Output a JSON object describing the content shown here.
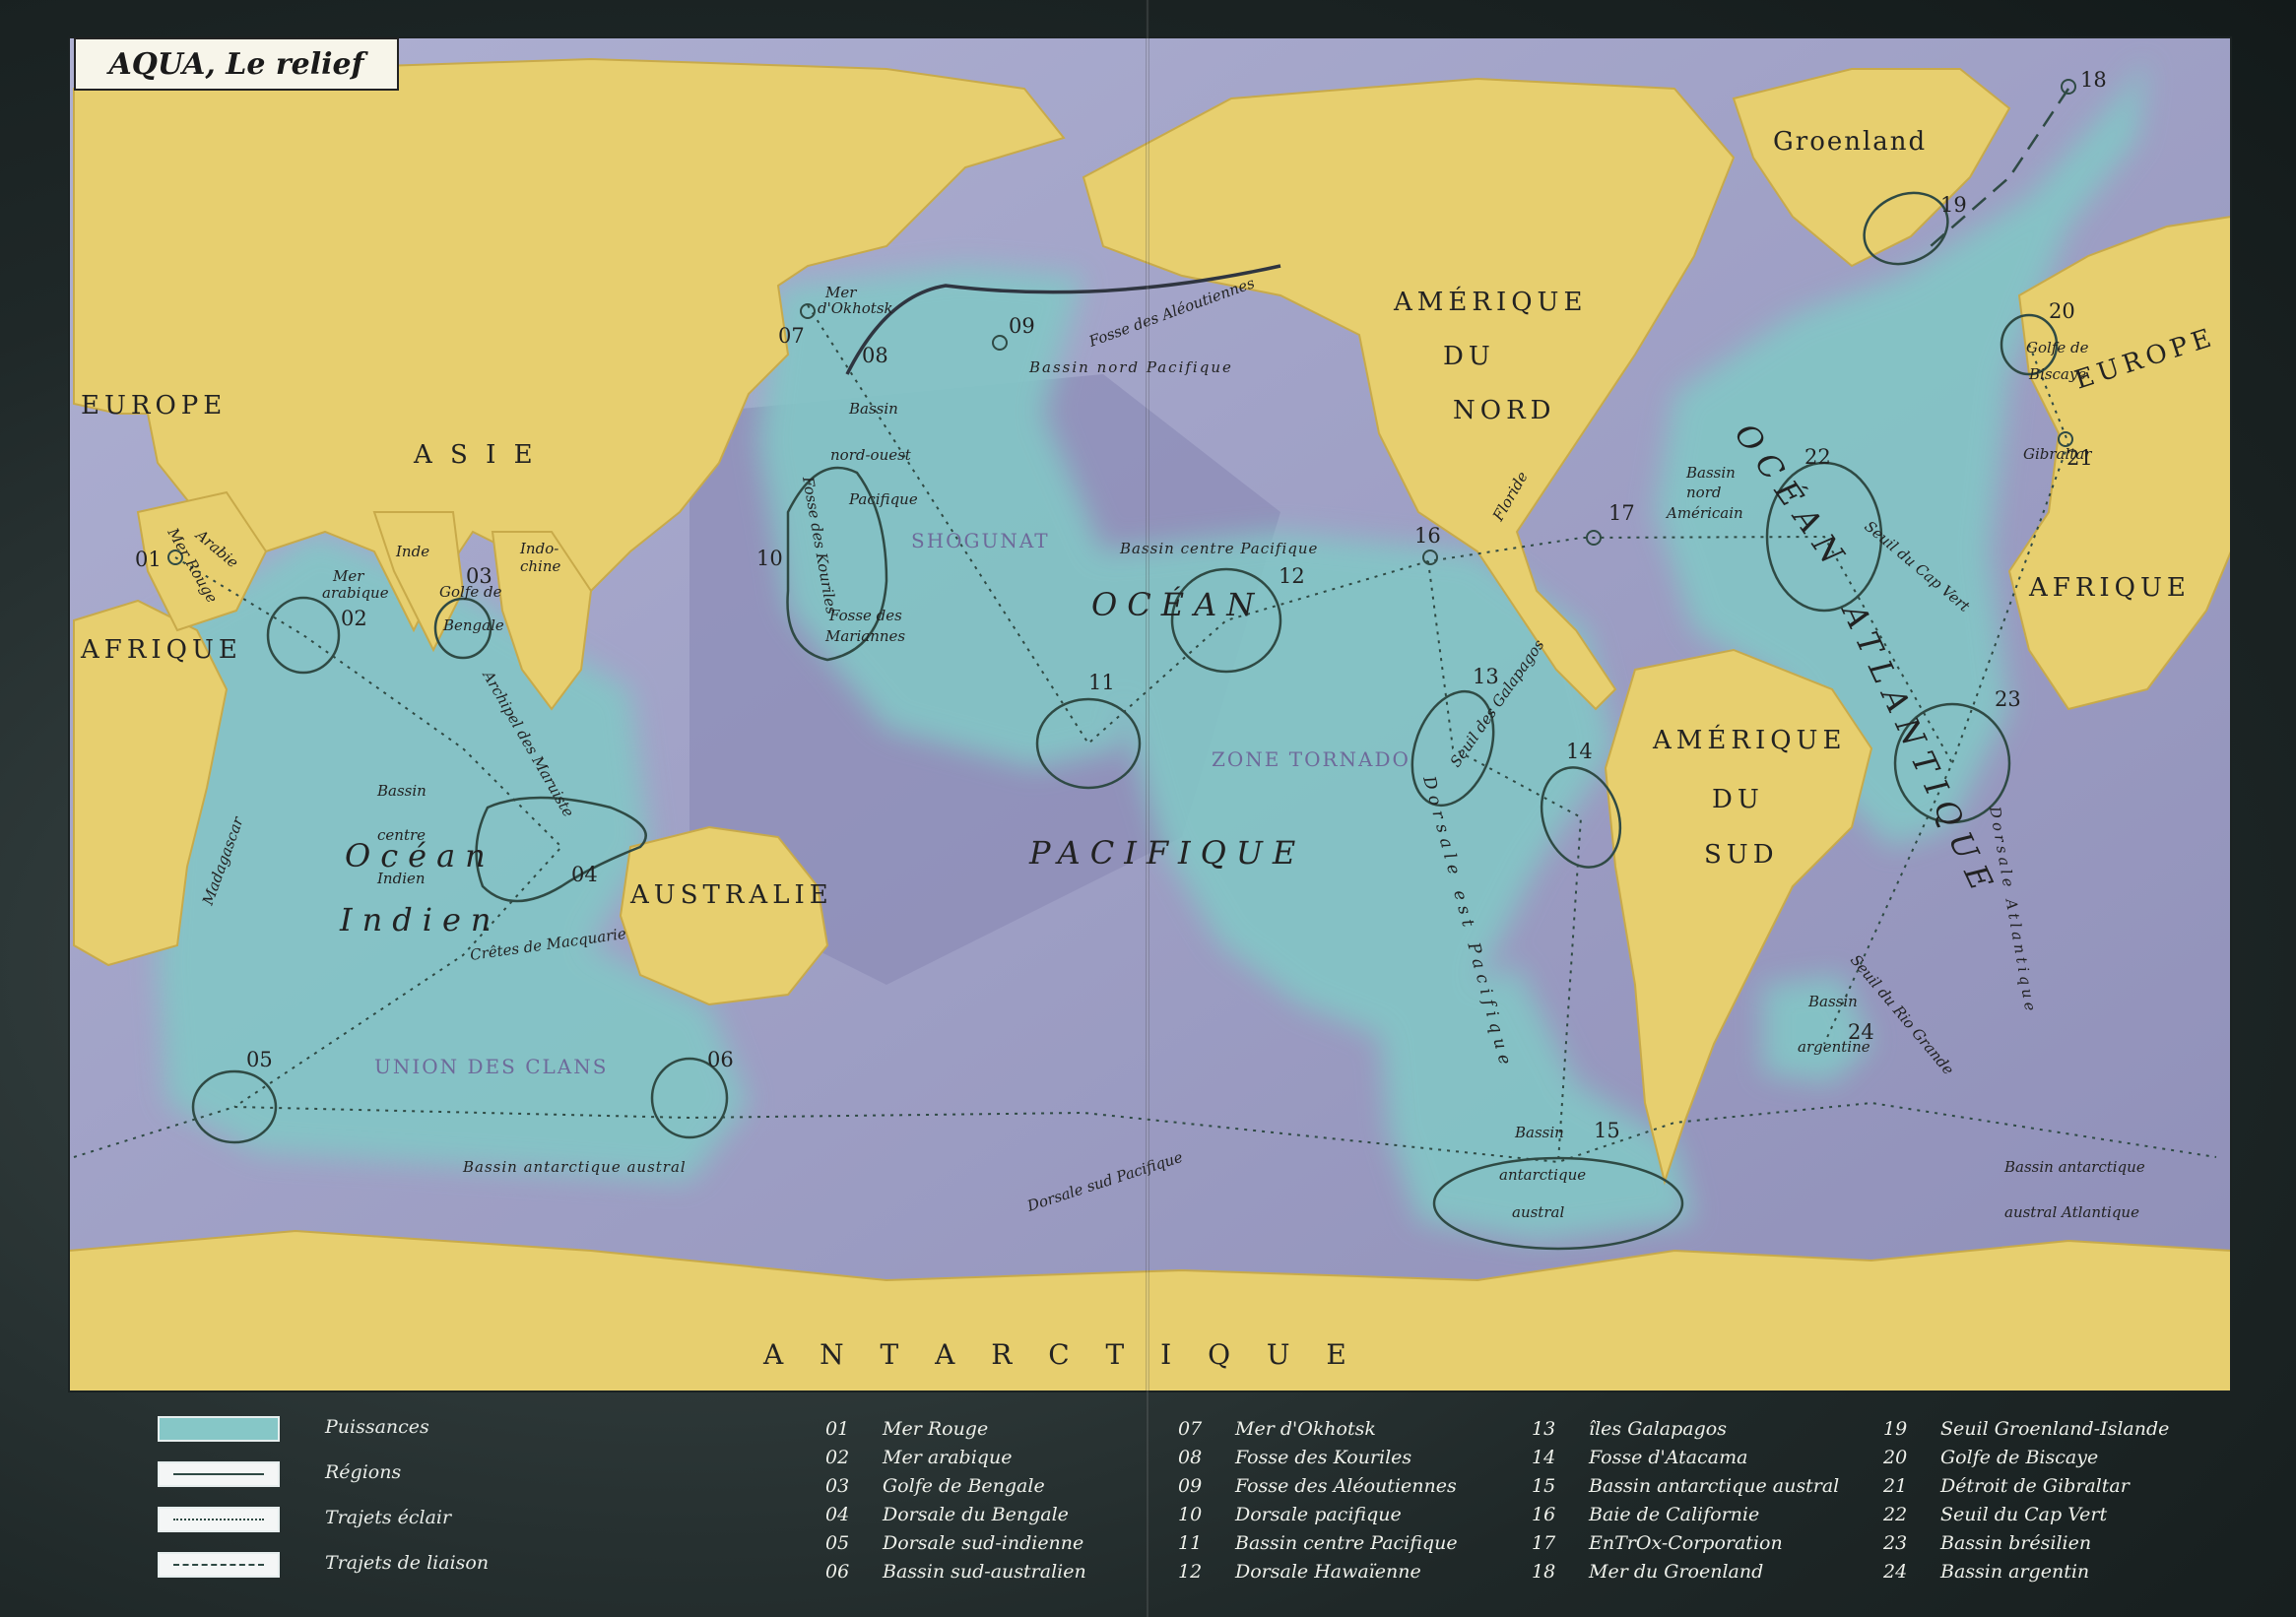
{
  "title": "AQUA, Le relief",
  "colors": {
    "land": "#e7cf6f",
    "ocean_deep": "#9c9bc2",
    "ocean_shelf": "#bdbfdc",
    "power_zone": "#86c7c7",
    "lines": "#2f4a44",
    "background": "#1f2828"
  },
  "map_labels": {
    "continents": {
      "europe_west": "EUROPE",
      "asie": "A S I E",
      "afrique_west": "AFRIQUE",
      "australie": "AUSTRALIE",
      "amerique_nord_1": "AMÉRIQUE",
      "amerique_nord_2": "DU",
      "amerique_nord_3": "NORD",
      "amerique_sud_1": "AMÉRIQUE",
      "amerique_sud_2": "DU",
      "amerique_sud_3": "SUD",
      "groenland": "Groenland",
      "europe_east": "EUROPE",
      "afrique_east": "AFRIQUE",
      "antarctique": "A N T A R C T I Q U E"
    },
    "oceans": {
      "indien_1": "Océan",
      "indien_2": "Indien",
      "pacifique_1": "OCÉAN",
      "pacifique_2": "PACIFIQUE",
      "atlantique_1": "OCÉAN",
      "atlantique_2": "ATLANTIQUE"
    },
    "regions": {
      "shogunat": "SHOGUNAT",
      "zone_tornado": "ZONE TORNADO",
      "union_des_clans": "UNION DES CLANS"
    },
    "features": {
      "mer_okhotsk_1": "Mer",
      "mer_okhotsk_2": "d'Okhotsk",
      "arabie": "Arabie",
      "mer_rouge": "Mer Rouge",
      "mer_arabique_1": "Mer",
      "mer_arabique_2": "arabique",
      "golfe_bengale_1": "Golfe de",
      "golfe_bengale_2": "Bengale",
      "inde": "Inde",
      "indochine_1": "Indo-",
      "indochine_2": "chine",
      "bassin_no_1": "Bassin",
      "bassin_no_2": "nord-ouest",
      "bassin_no_3": "Pacifique",
      "fosse_kouriles": "Fosse des Kouriles",
      "fosse_mariannes_1": "Fosse des",
      "fosse_mariannes_2": "Mariannes",
      "fosse_aleoutiennes": "Fosse des Aléoutiennes",
      "bassin_nord_pacifique": "Bassin nord Pacifique",
      "bassin_centre_pacifique": "Bassin centre Pacifique",
      "archipel_maruiste": "Archipel des Maruiste",
      "bassin_centre_indien_1": "Bassin",
      "bassin_centre_indien_2": "centre",
      "bassin_centre_indien_3": "Indien",
      "madagascar": "Madagascar",
      "cretes_macquarie": "Crêtes de Macquarie",
      "bassin_antarctique_austral": "Bassin antarctique austral",
      "dorsale_sud_pacifique": "Dorsale sud Pacifique",
      "dorsale_est_pacifique": "Dorsale est Pacifique",
      "seuil_galapagos": "Seuil des Galapagos",
      "floride": "Floride",
      "bassin_nord_americain_1": "Bassin",
      "bassin_nord_americain_2": "nord",
      "bassin_nord_americain_3": "Américain",
      "seuil_cap_vert": "Seuil du Cap Vert",
      "golfe_biscaye_1": "Golfe de",
      "golfe_biscaye_2": "Biscaye",
      "gibraltar": "Gibraltar",
      "dorsale_atlantique": "Dorsale Atlantique",
      "seuil_rio_grande": "Seuil du Rio Grande",
      "bassin_argentine_1": "Bassin",
      "bassin_argentine_2": "argentine",
      "bassin_austral_1": "Bassin",
      "bassin_austral_2": "antarctique",
      "bassin_austral_3": "austral",
      "bassin_antarctique_atl_1": "Bassin antarctique",
      "bassin_antarctique_atl_2": "austral Atlantique"
    },
    "markers": [
      "01",
      "02",
      "03",
      "04",
      "05",
      "06",
      "07",
      "08",
      "09",
      "10",
      "11",
      "12",
      "13",
      "14",
      "15",
      "16",
      "17",
      "18",
      "19",
      "20",
      "21",
      "22",
      "23",
      "24"
    ]
  },
  "legend": [
    {
      "label": "Puissances",
      "style": "fill"
    },
    {
      "label": "Régions",
      "style": "solid"
    },
    {
      "label": "Trajets éclair",
      "style": "dotted"
    },
    {
      "label": "Trajets de liaison",
      "style": "dashed"
    }
  ],
  "index": [
    {
      "num": "01",
      "name": "Mer Rouge"
    },
    {
      "num": "02",
      "name": "Mer arabique"
    },
    {
      "num": "03",
      "name": "Golfe de Bengale"
    },
    {
      "num": "04",
      "name": "Dorsale du Bengale"
    },
    {
      "num": "05",
      "name": "Dorsale sud-indienne"
    },
    {
      "num": "06",
      "name": "Bassin sud-australien"
    },
    {
      "num": "07",
      "name": "Mer d'Okhotsk"
    },
    {
      "num": "08",
      "name": "Fosse des Kouriles"
    },
    {
      "num": "09",
      "name": "Fosse des Aléoutiennes"
    },
    {
      "num": "10",
      "name": "Dorsale pacifique"
    },
    {
      "num": "11",
      "name": "Bassin centre Pacifique"
    },
    {
      "num": "12",
      "name": "Dorsale Hawaïenne"
    },
    {
      "num": "13",
      "name": "îles Galapagos"
    },
    {
      "num": "14",
      "name": "Fosse d'Atacama"
    },
    {
      "num": "15",
      "name": "Bassin antarctique austral"
    },
    {
      "num": "16",
      "name": "Baie de Californie"
    },
    {
      "num": "17",
      "name": "EnTrOx-Corporation"
    },
    {
      "num": "18",
      "name": "Mer du Groenland"
    },
    {
      "num": "19",
      "name": "Seuil Groenland-Islande"
    },
    {
      "num": "20",
      "name": "Golfe de Biscaye"
    },
    {
      "num": "21",
      "name": "Détroit de Gibraltar"
    },
    {
      "num": "22",
      "name": "Seuil du Cap Vert"
    },
    {
      "num": "23",
      "name": "Bassin brésilien"
    },
    {
      "num": "24",
      "name": "Bassin argentin"
    }
  ]
}
